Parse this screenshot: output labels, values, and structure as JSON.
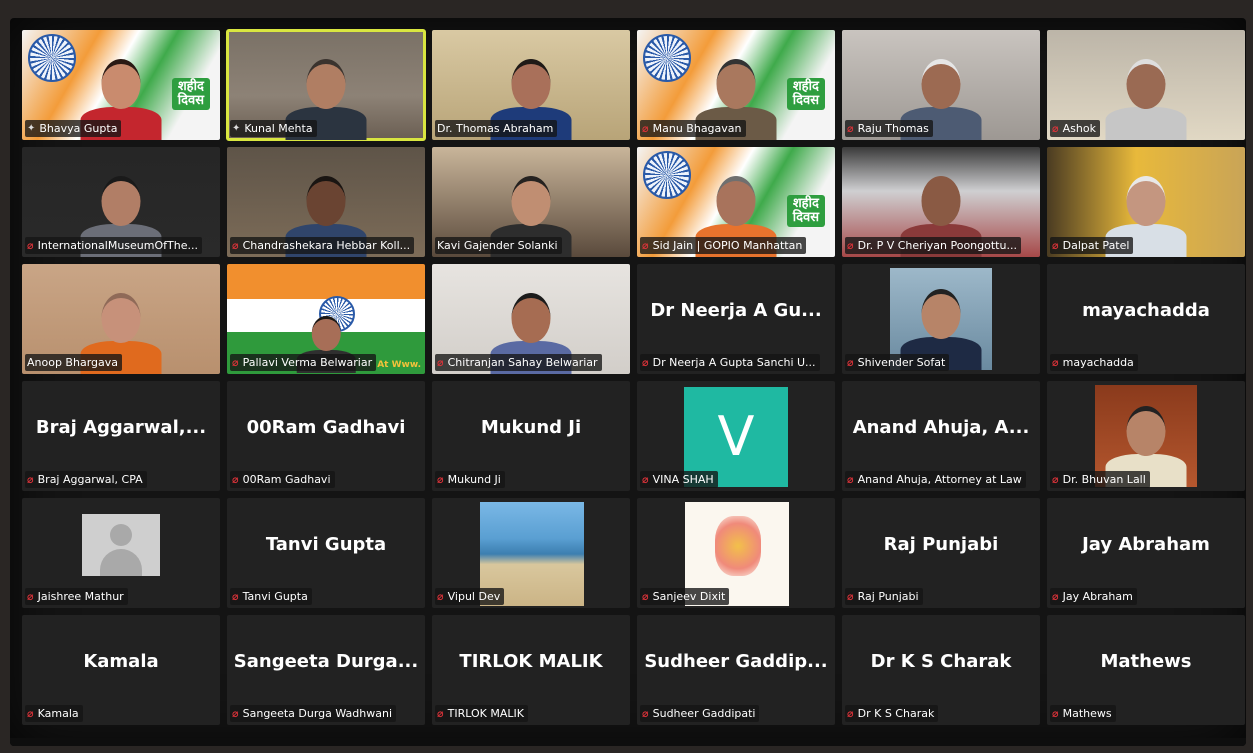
{
  "app": {
    "name": "Zoom meeting gallery view"
  },
  "participants": [
    {
      "name": "Bhavya Gupta",
      "label": "Bhavya Gupta",
      "muted": false,
      "pinned": true,
      "kind": "video-flag"
    },
    {
      "name": "Kunal Mehta",
      "label": "Kunal Mehta",
      "muted": false,
      "pinned": true,
      "kind": "video",
      "active": true
    },
    {
      "name": "Dr. Thomas Abraham",
      "label": "Dr. Thomas Abraham",
      "muted": false,
      "kind": "video"
    },
    {
      "name": "Manu Bhagavan",
      "label": "Manu Bhagavan",
      "muted": true,
      "kind": "video-flag"
    },
    {
      "name": "Raju Thomas",
      "label": "Raju Thomas",
      "muted": true,
      "kind": "video"
    },
    {
      "name": "Ashok",
      "label": "Ashok",
      "muted": true,
      "kind": "video"
    },
    {
      "name": "InternationalMuseumOfThe...",
      "label": "InternationalMuseumOfThe...",
      "muted": true,
      "kind": "video"
    },
    {
      "name": "Chandrashekara Hebbar Koll...",
      "label": "Chandrashekara Hebbar Koll...",
      "muted": true,
      "kind": "video"
    },
    {
      "name": "Kavi Gajender Solanki",
      "label": "Kavi Gajender Solanki",
      "muted": false,
      "kind": "video"
    },
    {
      "name": "Sid Jain | GOPIO Manhattan",
      "label": "Sid Jain | GOPIO Manhattan",
      "muted": true,
      "kind": "video-flag"
    },
    {
      "name": "Dr. P V Cheriyan Poongottu...",
      "label": "Dr. P V Cheriyan Poongottu...",
      "muted": true,
      "kind": "video"
    },
    {
      "name": "Dalpat Patel",
      "label": "Dalpat Patel",
      "muted": true,
      "kind": "video"
    },
    {
      "name": "Anoop Bhargava",
      "label": "Anoop Bhargava",
      "muted": false,
      "kind": "video"
    },
    {
      "name": "Pallavi Verma Belwariar",
      "label": "Pallavi Verma Belwariar",
      "muted": true,
      "kind": "video-flag2"
    },
    {
      "name": "Chitranjan Sahay Belwariar",
      "label": "Chitranjan Sahay Belwariar",
      "muted": true,
      "kind": "video"
    },
    {
      "name": "Dr Neerja A Gu...",
      "label": "Dr Neerja A Gupta Sanchi U...",
      "muted": true,
      "kind": "name"
    },
    {
      "name": "Shivender Sofat",
      "label": "Shivender Sofat",
      "muted": true,
      "kind": "photo"
    },
    {
      "name": "mayachadda",
      "label": "mayachadda",
      "muted": true,
      "kind": "name"
    },
    {
      "name": "Braj  Aggarwal,...",
      "label": "Braj Aggarwal, CPA",
      "muted": true,
      "kind": "name"
    },
    {
      "name": "00Ram Gadhavi",
      "label": "00Ram Gadhavi",
      "muted": true,
      "kind": "name"
    },
    {
      "name": "Mukund Ji",
      "label": "Mukund Ji",
      "muted": true,
      "kind": "name"
    },
    {
      "name": "V",
      "label": "VINA SHAH",
      "muted": true,
      "kind": "initial"
    },
    {
      "name": "Anand Ahuja, A...",
      "label": "Anand Ahuja, Attorney at Law",
      "muted": true,
      "kind": "name"
    },
    {
      "name": "Dr. Bhuvan Lall",
      "label": "Dr. Bhuvan Lall",
      "muted": true,
      "kind": "photo"
    },
    {
      "name": "Jaishree Mathur",
      "label": "Jaishree Mathur",
      "muted": true,
      "kind": "avatar"
    },
    {
      "name": "Tanvi Gupta",
      "label": "Tanvi Gupta",
      "muted": true,
      "kind": "name"
    },
    {
      "name": "Vipul Dev",
      "label": "Vipul Dev",
      "muted": true,
      "kind": "beach"
    },
    {
      "name": "Sanjeev Dixit",
      "label": "Sanjeev Dixit",
      "muted": true,
      "kind": "drawing"
    },
    {
      "name": "Raj Punjabi",
      "label": "Raj Punjabi",
      "muted": true,
      "kind": "name"
    },
    {
      "name": "Jay Abraham",
      "label": "Jay Abraham",
      "muted": true,
      "kind": "name"
    },
    {
      "name": "Kamala",
      "label": "Kamala",
      "muted": true,
      "kind": "name"
    },
    {
      "name": "Sangeeta  Durga...",
      "label": "Sangeeta Durga Wadhwani",
      "muted": true,
      "kind": "name"
    },
    {
      "name": "TIRLOK MALIK",
      "label": "TIRLOK MALIK",
      "muted": true,
      "kind": "name"
    },
    {
      "name": "Sudheer  Gaddip...",
      "label": "Sudheer Gaddipati",
      "muted": true,
      "kind": "name"
    },
    {
      "name": "Dr K S Charak",
      "label": "Dr K S Charak",
      "muted": true,
      "kind": "name"
    },
    {
      "name": "Mathews",
      "label": "Mathews",
      "muted": true,
      "kind": "name"
    }
  ],
  "banner_text": {
    "line1": "शहीद",
    "line2": "दिवस"
  },
  "overlay_tag": "At Www.",
  "colors": {
    "muted_icon": "#e0333a",
    "active_speaker": "#d9e640",
    "initial_tile": "#1fb9a2"
  },
  "icons": {
    "muted": "mic-off-icon",
    "pinned": "pin-icon"
  }
}
